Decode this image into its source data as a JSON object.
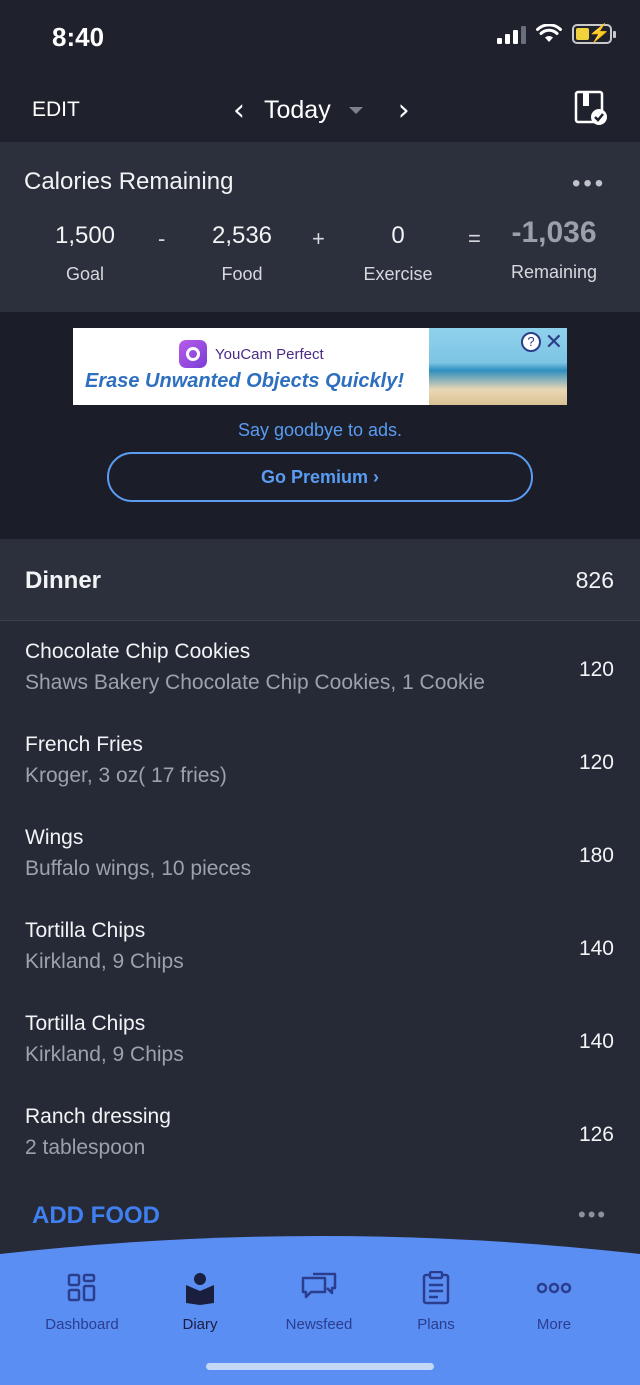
{
  "status_bar": {
    "time": "8:40",
    "icons": [
      "signal-icon",
      "wifi-icon",
      "battery-charging-icon"
    ]
  },
  "header": {
    "edit_label": "EDIT",
    "date_label": "Today",
    "icons": [
      "chevron-left-icon",
      "caret-down-icon",
      "chevron-right-icon",
      "calendar-check-icon"
    ]
  },
  "calories": {
    "title": "Calories Remaining",
    "more_label": "•••",
    "goal": {
      "value": "1,500",
      "label": "Goal"
    },
    "food": {
      "value": "2,536",
      "label": "Food"
    },
    "exercise": {
      "value": "0",
      "label": "Exercise"
    },
    "remaining": {
      "value": "-1,036",
      "label": "Remaining"
    },
    "ops": {
      "minus": "-",
      "plus": "+",
      "equals": "="
    }
  },
  "ad": {
    "brand": "YouCam Perfect",
    "headline": "Erase Unwanted Objects Quickly!",
    "help": "?",
    "close": "✕",
    "tagline": "Say goodbye to ads.",
    "premium_label": "Go Premium ›"
  },
  "meal": {
    "title": "Dinner",
    "total": "826",
    "items": [
      {
        "name": "Chocolate Chip Cookies",
        "desc": "Shaws Bakery Chocolate Chip Cookies, 1 Cookie",
        "cal": "120"
      },
      {
        "name": "French Fries",
        "desc": "Kroger, 3 oz( 17 fries)",
        "cal": "120"
      },
      {
        "name": "Wings",
        "desc": "Buffalo wings, 10 pieces",
        "cal": "180"
      },
      {
        "name": "Tortilla Chips",
        "desc": "Kirkland, 9 Chips",
        "cal": "140"
      },
      {
        "name": "Tortilla Chips",
        "desc": "Kirkland, 9 Chips",
        "cal": "140"
      },
      {
        "name": "Ranch dressing",
        "desc": "2 tablespoon",
        "cal": "126"
      }
    ],
    "add_label": "ADD FOOD",
    "add_more": "•••"
  },
  "tabs": [
    {
      "label": "Dashboard",
      "icon": "dashboard-grid-icon"
    },
    {
      "label": "Diary",
      "icon": "diary-book-icon"
    },
    {
      "label": "Newsfeed",
      "icon": "newsfeed-chat-icon"
    },
    {
      "label": "Plans",
      "icon": "plans-clipboard-icon"
    },
    {
      "label": "More",
      "icon": "more-dots-icon"
    }
  ],
  "colors": {
    "background": "#262a36",
    "accent": "#3f7ff0",
    "tabbar": "#5a8ef3",
    "tab_label": "#2b3d8f"
  }
}
